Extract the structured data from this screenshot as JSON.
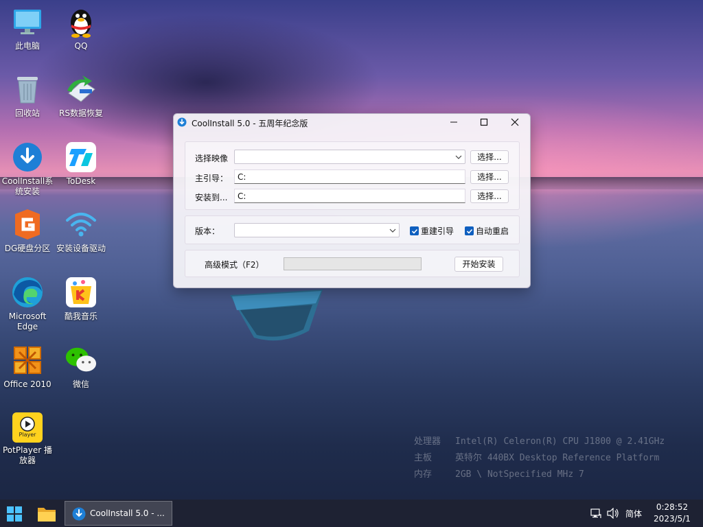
{
  "desktop": {
    "icons": [
      {
        "label": "此电脑"
      },
      {
        "label": "QQ"
      },
      {
        "label": "回收站"
      },
      {
        "label": "RS数据恢复"
      },
      {
        "label": "CoolInstall系统安装"
      },
      {
        "label": "ToDesk"
      },
      {
        "label": "DG硬盘分区"
      },
      {
        "label": "安装设备驱动"
      },
      {
        "label": "Microsoft Edge"
      },
      {
        "label": "酷我音乐"
      },
      {
        "label": "Office 2010"
      },
      {
        "label": "微信"
      },
      {
        "label": "PotPlayer 播放器",
        "badge": "Player"
      }
    ]
  },
  "sysinfo": {
    "cpu_label": "处理器",
    "cpu_value": "Intel(R) Celeron(R) CPU  J1800  @ 2.41GHz",
    "board_label": "主板",
    "board_value": "英特尔 440BX Desktop Reference Platform",
    "mem_label": "内存",
    "mem_value": "2GB \\ NotSpecified  MHz 7"
  },
  "window": {
    "title": "CoolInstall 5.0 - 五周年纪念版",
    "image_label": "选择映像",
    "image_value": "",
    "boot_label": "主引导：",
    "boot_value": "C:",
    "install_label": "安装到...",
    "install_value": "C:",
    "browse_label": "选择...",
    "edition_label": "版本：",
    "edition_value": "",
    "rebuild_boot_label": "重建引导",
    "rebuild_boot_checked": true,
    "auto_restart_label": "自动重启",
    "auto_restart_checked": true,
    "advanced_label": "高级模式（F2）",
    "progress": 0,
    "start_label": "开始安装"
  },
  "taskbar": {
    "app_label": "CoolInstall 5.0 - ...",
    "ime": "简体",
    "time": "0:28:52",
    "date": "2023/5/1"
  },
  "colors": {
    "accent": "#0f5fbf",
    "taskbar": "#1e2232"
  }
}
